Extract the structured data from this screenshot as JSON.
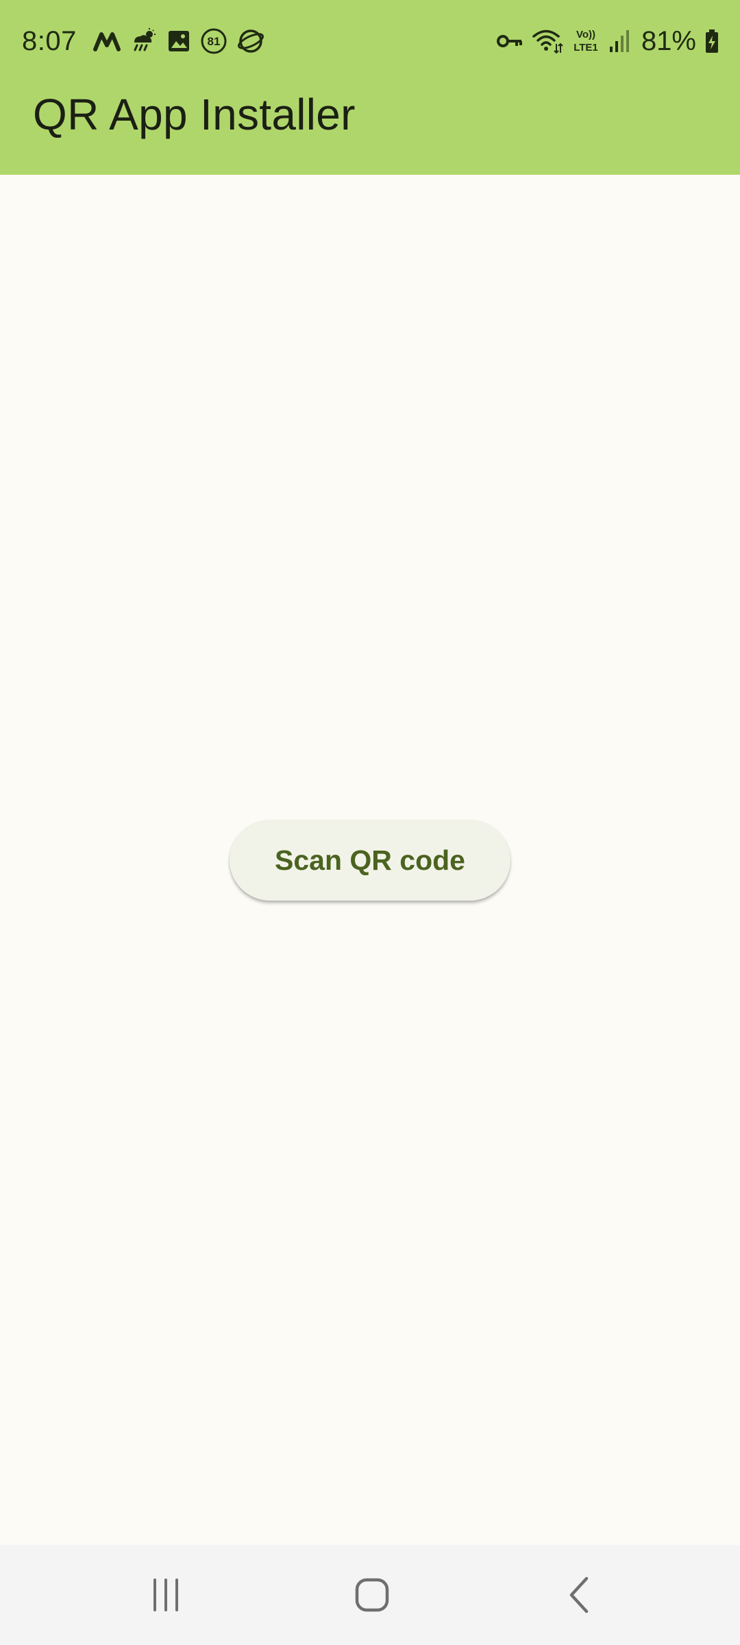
{
  "status_bar": {
    "time": "8:07",
    "battery_percent": "81%",
    "notification_badge": "81",
    "network_label_top": "Vo))",
    "network_label_bottom": "LTE1",
    "left_icons": [
      "m-logo-icon",
      "weather-rain-icon",
      "gallery-icon",
      "badge-81-icon",
      "browser-icon"
    ],
    "right_icons": [
      "vpn-key-icon",
      "wifi-icon",
      "volte-lte-icon",
      "signal-icon",
      "battery-charging-icon"
    ]
  },
  "app_bar": {
    "title": "QR App Installer"
  },
  "main": {
    "scan_button_label": "Scan QR code"
  },
  "nav_bar": {
    "items": [
      "recents-icon",
      "home-icon",
      "back-icon"
    ]
  },
  "colors": {
    "header_bg": "#afd66b",
    "page_bg": "#fcfbf6",
    "button_bg": "#f2f3e8",
    "button_text": "#4b6320",
    "nav_bg": "#f4f4f4"
  }
}
